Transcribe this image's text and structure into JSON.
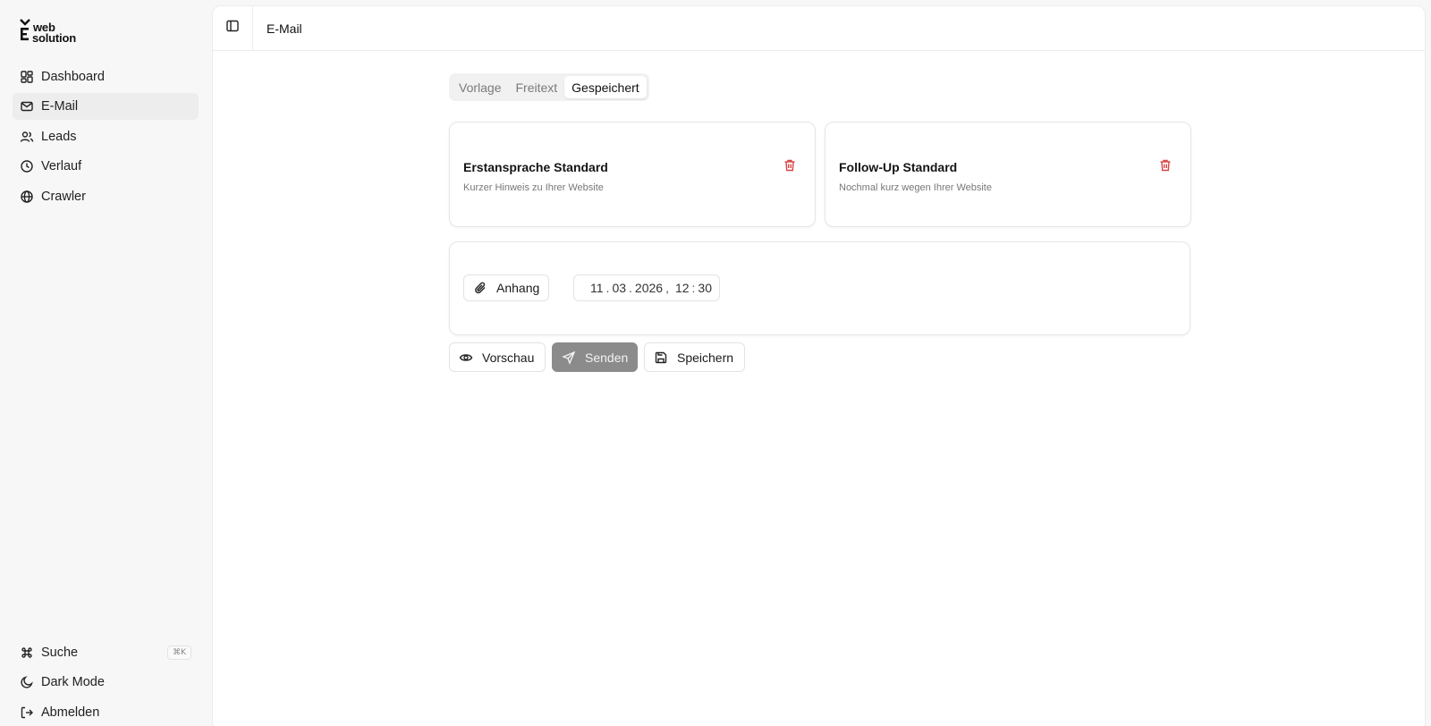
{
  "app": {
    "logo_line1": "web",
    "logo_line2": "solution"
  },
  "sidebar": {
    "items": [
      {
        "label": "Dashboard",
        "icon": "dashboard-icon"
      },
      {
        "label": "E-Mail",
        "icon": "mail-icon",
        "active": true
      },
      {
        "label": "Leads",
        "icon": "users-icon"
      },
      {
        "label": "Verlauf",
        "icon": "clock-icon"
      },
      {
        "label": "Crawler",
        "icon": "globe-icon"
      }
    ],
    "bottom": [
      {
        "label": "Suche",
        "icon": "command-icon",
        "shortcut": "⌘K"
      },
      {
        "label": "Dark Mode",
        "icon": "moon-icon"
      },
      {
        "label": "Abmelden",
        "icon": "logout-icon"
      }
    ]
  },
  "header": {
    "title": "E-Mail"
  },
  "tabs": [
    {
      "label": "Vorlage"
    },
    {
      "label": "Freitext"
    },
    {
      "label": "Gespeichert",
      "active": true
    }
  ],
  "saved_templates": [
    {
      "title": "Erstansprache Standard",
      "subject": "Kurzer Hinweis zu Ihrer Website"
    },
    {
      "title": "Follow-Up Standard",
      "subject": "Nochmal kurz wegen Ihrer Website"
    }
  ],
  "compose": {
    "attachment_label": "Anhang",
    "schedule": {
      "day": "11",
      "month": "03",
      "year": "2026",
      "hour": "12",
      "minute": "30"
    }
  },
  "actions": {
    "preview_label": "Vorschau",
    "send_label": "Senden",
    "save_label": "Speichern"
  },
  "colors": {
    "delete": "#d64545",
    "send_disabled_bg": "#8b8b8b",
    "active_nav_bg": "#ededed"
  }
}
